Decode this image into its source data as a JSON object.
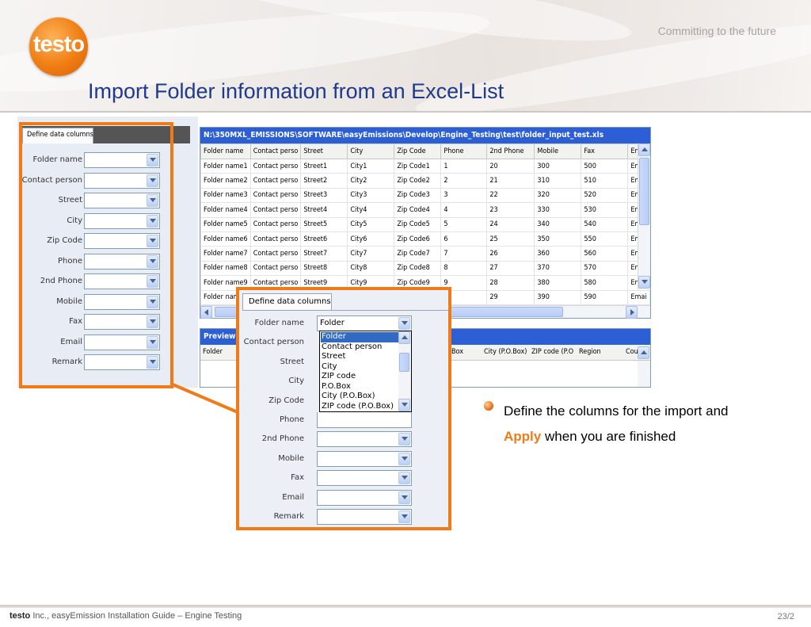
{
  "header": {
    "logo_text": "testo",
    "tagline": "Committing to the future",
    "title": "Import Folder information from an Excel-List"
  },
  "left_panel": {
    "tab_label": "Define data columns",
    "fields": [
      "Folder name",
      "Contact person",
      "Street",
      "City",
      "Zip Code",
      "Phone",
      "2nd Phone",
      "Mobile",
      "Fax",
      "Email",
      "Remark"
    ]
  },
  "sheet": {
    "path": "N:\\350MXL_EMISSIONS\\SOFTWARE\\easyEmissions\\Develop\\Engine_Testing\\test\\folder_input_test.xls",
    "columns": [
      "Folder name",
      "Contact perso",
      "Street",
      "City",
      "Zip Code",
      "Phone",
      "2nd Phone",
      "Mobile",
      "Fax",
      "Ema"
    ],
    "rows": [
      [
        "Folder name1",
        "Contact perso",
        "Street1",
        "City1",
        "Zip Code1",
        "1",
        "20",
        "300",
        "500",
        "Emai"
      ],
      [
        "Folder name2",
        "Contact perso",
        "Street2",
        "City2",
        "Zip Code2",
        "2",
        "21",
        "310",
        "510",
        "Emai"
      ],
      [
        "Folder name3",
        "Contact perso",
        "Street3",
        "City3",
        "Zip Code3",
        "3",
        "22",
        "320",
        "520",
        "Emai"
      ],
      [
        "Folder name4",
        "Contact perso",
        "Street4",
        "City4",
        "Zip Code4",
        "4",
        "23",
        "330",
        "530",
        "Emai"
      ],
      [
        "Folder name5",
        "Contact perso",
        "Street5",
        "City5",
        "Zip Code5",
        "5",
        "24",
        "340",
        "540",
        "Emai"
      ],
      [
        "Folder name6",
        "Contact perso",
        "Street6",
        "City6",
        "Zip Code6",
        "6",
        "25",
        "350",
        "550",
        "Emai"
      ],
      [
        "Folder name7",
        "Contact perso",
        "Street7",
        "City7",
        "Zip Code7",
        "7",
        "26",
        "360",
        "560",
        "Emai"
      ],
      [
        "Folder name8",
        "Contact perso",
        "Street8",
        "City8",
        "Zip Code8",
        "8",
        "27",
        "370",
        "570",
        "Emai"
      ],
      [
        "Folder name9",
        "Contact perso",
        "Street9",
        "City9",
        "Zip Code9",
        "9",
        "28",
        "380",
        "580",
        "Emai"
      ],
      [
        "Folder nam",
        "",
        "",
        "",
        "",
        "",
        "29",
        "390",
        "590",
        "Emai"
      ]
    ]
  },
  "preview": {
    "title": "Preview o",
    "columns": [
      "Folder",
      "Box",
      "City (P.O.Box)",
      "ZIP code (P.O",
      "Region",
      "Cou"
    ]
  },
  "popup": {
    "tab_label": "Define data columns",
    "fields": [
      "Folder name",
      "Contact person",
      "Street",
      "City",
      "Zip Code",
      "Phone",
      "2nd Phone",
      "Mobile",
      "Fax",
      "Email",
      "Remark"
    ],
    "folder_name_value": "Folder",
    "dropdown_options": [
      "Folder",
      "Contact person",
      "Street",
      "City",
      "ZIP code",
      "P.O.Box",
      "City (P.O.Box)",
      "ZIP code (P.O.Box)"
    ],
    "selected_option": "Folder"
  },
  "bullet": {
    "before": "Define the columns for the import and ",
    "highlight": "Apply",
    "after": " when you are finished"
  },
  "footer": {
    "company": "testo",
    "text": " Inc., easyEmission Installation Guide – Engine Testing",
    "page": "23/2"
  },
  "colors": {
    "title": "#1f3a8c",
    "highlight": "#f07a18",
    "titlebar": "#2c5ed6"
  }
}
